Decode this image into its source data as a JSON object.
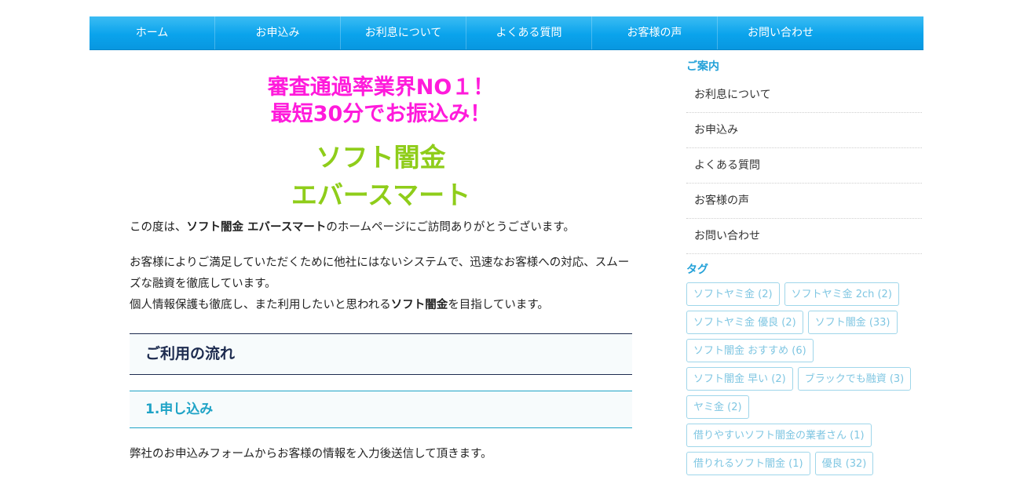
{
  "nav": {
    "items": [
      "ホーム",
      "お申込み",
      "お利息について",
      "よくある質問",
      "お客様の声",
      "お問い合わせ"
    ]
  },
  "main": {
    "headline_line1": "審査通過率業界NO１！",
    "headline_line2": "最短30分でお振込み！",
    "brand_line1": "ソフト闇金",
    "brand_line2": "エバースマート",
    "p1_before": "この度は、",
    "p1_bold": "ソフト闇金 エバースマート",
    "p1_after": "のホームページにご訪問ありがとうございます。",
    "p2_line1": "お客様によりご満足していただくために他社にはないシステムで、迅速なお客様への対応、スムーズな融資を徹底しています。",
    "p2_line2_before": "個人情報保護も徹底し、また利用したいと思われる",
    "p2_line2_bold": "ソフト闇金",
    "p2_line2_after": "を目指しています。",
    "section_heading": "ご利用の流れ",
    "step1_heading": "1.申し込み",
    "step1_text": "弊社のお申込みフォームからお客様の情報を入力後送信して頂きます。"
  },
  "sidebar": {
    "guide_title": "ご案内",
    "guide_items": [
      "お利息について",
      "お申込み",
      "よくある質問",
      "お客様の声",
      "お問い合わせ"
    ],
    "tag_title": "タグ",
    "tags": [
      "ソフトヤミ金 (2)",
      "ソフトヤミ金 2ch (2)",
      "ソフトヤミ金 優良 (2)",
      "ソフト闇金 (33)",
      "ソフト闇金 おすすめ (6)",
      "ソフト闇金 早い (2)",
      "ブラックでも融資 (3)",
      "ヤミ金 (2)",
      "借りやすいソフト闇金の業者さん (1)",
      "借りれるソフト闇金 (1)",
      "優良 (32)"
    ]
  }
}
